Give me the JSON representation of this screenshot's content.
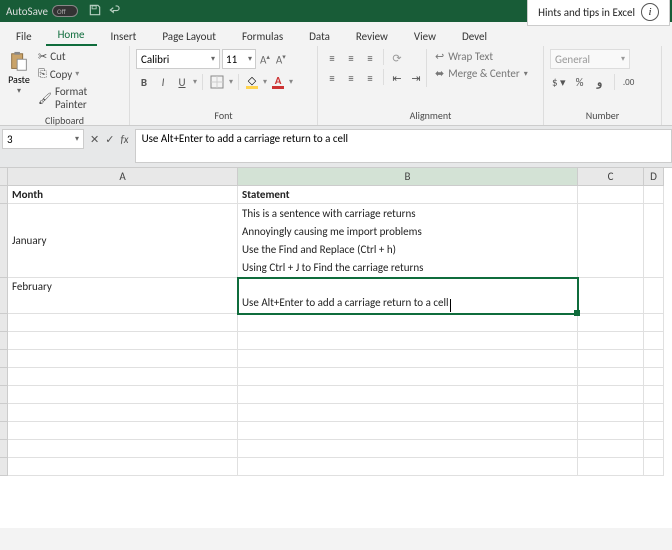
{
  "title_bar": {
    "autosave": "AutoSave",
    "autosave_state": "Off"
  },
  "hints": {
    "text": "Hints and tips in Excel"
  },
  "tabs": {
    "file": "File",
    "home": "Home",
    "insert": "Insert",
    "page_layout": "Page Layout",
    "formulas": "Formulas",
    "data": "Data",
    "review": "Review",
    "view": "View",
    "developer": "Devel"
  },
  "clipboard": {
    "paste": "Paste",
    "cut": "Cut",
    "copy": "Copy",
    "format_painter": "Format Painter",
    "label": "Clipboard"
  },
  "font": {
    "name": "Calibri",
    "size": "11",
    "label": "Font",
    "bold": "B",
    "italic": "I",
    "underline": "U",
    "fill": "A"
  },
  "alignment": {
    "wrap": "Wrap Text",
    "merge": "Merge & Center",
    "label": "Alignment"
  },
  "number": {
    "format": "General",
    "label": "Number",
    "pct": "%",
    "comma": "،"
  },
  "formula_bar": {
    "name_box": "3",
    "fx": "fx",
    "content": "Use Alt+Enter to add a carriage return to a cell"
  },
  "columns": {
    "A": "A",
    "B": "B",
    "C": "C",
    "D": "D"
  },
  "sheet": {
    "A1": "Month",
    "B1": "Statement",
    "A2": "January",
    "B2": "This is a sentence with carriage returns\nAnnoyingly causing me import problems\nUse the Find and Replace (Ctrl + h)\nUsing Ctrl + J to Find the carriage returns",
    "A3": "February",
    "B3": "Use Alt+Enter to add a carriage return to a cell"
  }
}
